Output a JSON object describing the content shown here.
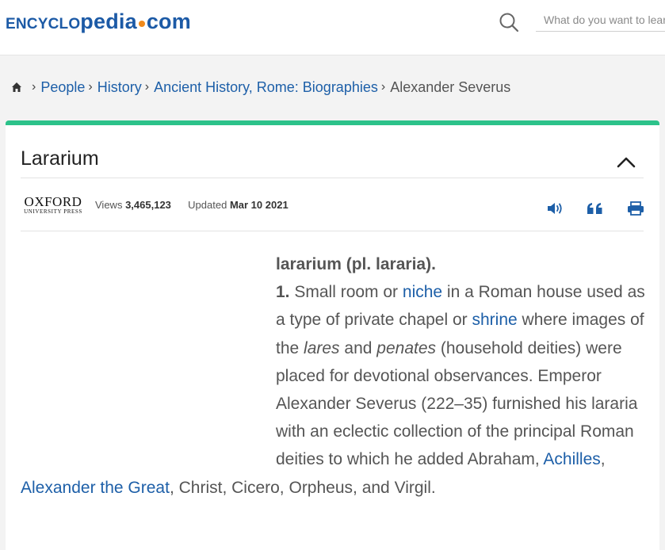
{
  "header": {
    "logo": {
      "part1": "ENCYCLO",
      "part2": "pedia",
      "part3": "com"
    },
    "search": {
      "placeholder": "What do you want to learn today?"
    }
  },
  "breadcrumb": [
    {
      "label": "People"
    },
    {
      "label": "History"
    },
    {
      "label": "Ancient History, Rome: Biographies"
    },
    {
      "label": "Alexander Severus"
    }
  ],
  "article": {
    "title": "Lararium",
    "publisher": {
      "line1": "OXFORD",
      "line2": "UNIVERSITY PRESS"
    },
    "views_label": "Views",
    "views_count": "3,465,123",
    "updated_label": "Updated",
    "updated_date": "Mar 10 2021",
    "body": {
      "term": "lararium (pl. lararia).",
      "number": "1.",
      "t1": " Small room or ",
      "link_niche": "niche",
      "t2": " in a Roman house used as a type of private chapel or ",
      "link_shrine": "shrine",
      "t3": " where images of the ",
      "lares": "lares",
      "t4": " and ",
      "penates": "penates",
      "t5": " (household deities) were placed for devotional observances. Emperor Alexander Severus (222–35) furnished his lararia with an eclectic collection of the principal Roman deities to which he added Abraham, ",
      "link_achilles": "Achilles",
      "t6": ", ",
      "link_alexander": "Alexander the Great",
      "t7": ", Christ, Cicero, Orpheus, and Virgil."
    }
  },
  "icons": {
    "home": "home-icon",
    "search": "search-icon",
    "collapse": "chevron-up-icon",
    "audio": "speaker-icon",
    "cite": "quote-icon",
    "print": "printer-icon"
  },
  "colors": {
    "brand": "#1c5aa6",
    "accent": "#2cc28a",
    "logo_dot": "#f08a1c",
    "link": "#1d5fa8"
  }
}
